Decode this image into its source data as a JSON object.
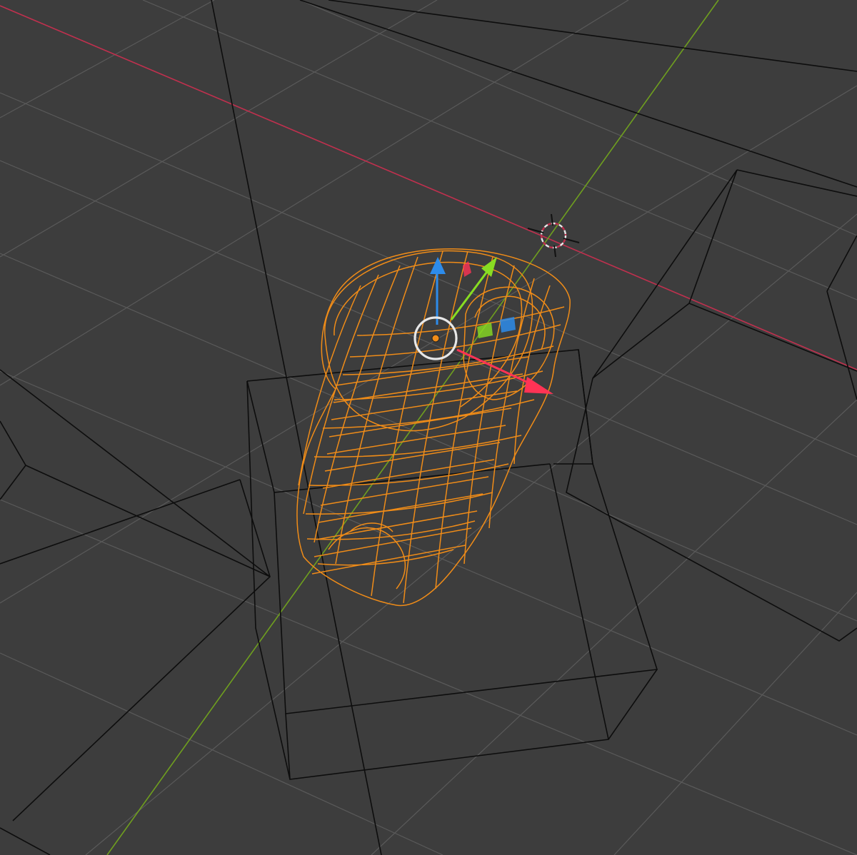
{
  "viewport": {
    "name": "3D Viewport",
    "shading": "wireframe",
    "colors": {
      "background": "#3d3d3d",
      "grid": "#5a5a5a",
      "axis_x": "#c0304e",
      "axis_y": "#6f9f1f",
      "wire": "#0d0d0d",
      "selected": "#f08c18",
      "gizmo_x": "#ff3355",
      "gizmo_y": "#88dd22",
      "gizmo_z": "#2d8ceb",
      "cursor": "#e7e7e7"
    },
    "selected_object": {
      "type": "mesh",
      "selected": true,
      "mode": "object"
    },
    "gizmo": {
      "type": "move",
      "icon": "transform-gizmo-icon",
      "axes": [
        "x",
        "y",
        "z"
      ]
    },
    "cursor_3d": {
      "icon": "3d-cursor-icon"
    }
  }
}
